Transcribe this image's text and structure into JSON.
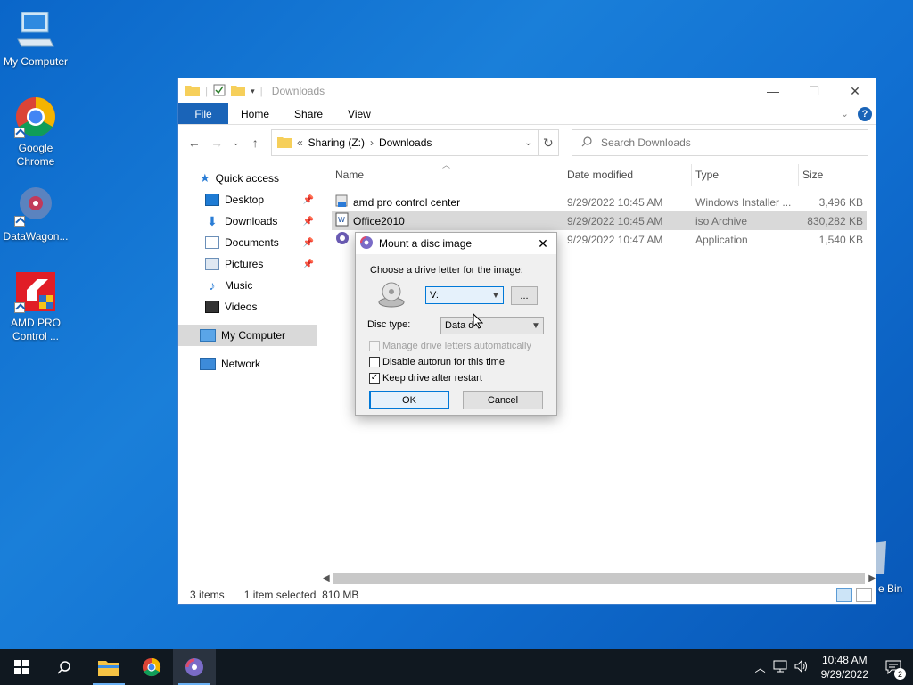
{
  "desktop": {
    "icons": [
      {
        "label": "My Computer"
      },
      {
        "label": "Google\nChrome"
      },
      {
        "label": "DataWagon..."
      },
      {
        "label": "AMD PRO\nControl ..."
      }
    ],
    "recycle_label": "e Bin"
  },
  "explorer": {
    "title": "Downloads",
    "ribbon_tabs": [
      "File",
      "Home",
      "Share",
      "View"
    ],
    "address": {
      "root": "Sharing (Z:)",
      "folder": "Downloads"
    },
    "search_placeholder": "Search Downloads",
    "nav": [
      {
        "label": "Quick access"
      },
      {
        "label": "Desktop"
      },
      {
        "label": "Downloads"
      },
      {
        "label": "Documents"
      },
      {
        "label": "Pictures"
      },
      {
        "label": "Music"
      },
      {
        "label": "Videos"
      },
      {
        "label": "My Computer"
      },
      {
        "label": "Network"
      }
    ],
    "columns": [
      "Name",
      "Date modified",
      "Type",
      "Size"
    ],
    "files": [
      {
        "name": "amd pro control center",
        "date": "9/29/2022 10:45 AM",
        "type": "Windows Installer ...",
        "size": "3,496 KB"
      },
      {
        "name": "Office2010",
        "date": "9/29/2022 10:45 AM",
        "type": "iso Archive",
        "size": "830,282 KB"
      },
      {
        "name": "",
        "date": "9/29/2022 10:47 AM",
        "type": "Application",
        "size": "1,540 KB"
      }
    ],
    "status": {
      "items": "3 items",
      "selected": "1 item selected",
      "size": "810 MB"
    }
  },
  "dialog": {
    "title": "Mount a disc image",
    "choose_label": "Choose a drive letter for the image:",
    "drive_value": "V:",
    "browse_label": "...",
    "disc_type_label": "Disc type:",
    "disc_type_value": "Data d",
    "manage_label": "Manage drive letters automatically",
    "autorun_label": "Disable autorun for this time",
    "keep_label": "Keep drive after restart",
    "ok_label": "OK",
    "cancel_label": "Cancel"
  },
  "taskbar": {
    "time": "10:48 AM",
    "date": "9/29/2022",
    "notifications": "2"
  },
  "colors": {
    "accent": "#1a64b8",
    "selection": "#d9d9d9",
    "dialog_focus": "#0078d7"
  }
}
